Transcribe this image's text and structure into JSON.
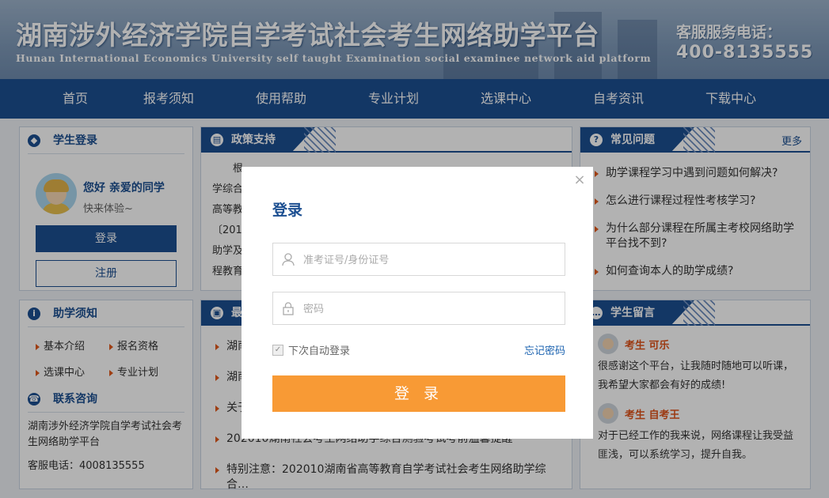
{
  "header": {
    "title": "湖南涉外经济学院自学考试社会考生网络助学平台",
    "subtitle": "Hunan International Economics University self taught Examination social examinee network aid platform",
    "hotline_label": "客服服务电话：",
    "hotline_number": "400-8135555"
  },
  "nav": {
    "items": [
      "首页",
      "报考须知",
      "使用帮助",
      "专业计划",
      "选课中心",
      "自考资讯",
      "下载中心"
    ]
  },
  "student_login": {
    "title": "学生登录",
    "greeting": "您好 亲爱的同学",
    "greeting_sub": "快来体验~",
    "login_label": "登录",
    "register_label": "注册"
  },
  "guide": {
    "title": "助学须知",
    "links": [
      "基本介绍",
      "报名资格",
      "选课中心",
      "专业计划"
    ]
  },
  "contact": {
    "title": "联系咨询",
    "text": "湖南涉外经济学院自学考试社会考生网络助学平台",
    "phone": "客服电话：4008135555"
  },
  "policy": {
    "title": "政策支持",
    "lines": [
      "根",
      "学综合",
      "高等教",
      "〔201",
      "助学及",
      "程教育"
    ]
  },
  "latest": {
    "title": "最",
    "items": [
      "湖南",
      "湖南",
      "关于",
      "202010湖南社会考生网络助学综合测验考试考前温馨提醒",
      "特别注意：202010湖南省高等教育自学考试社会考生网络助学综合…"
    ]
  },
  "faq": {
    "title": "常见问题",
    "more": "更多",
    "items": [
      "助学课程学习中遇到问题如何解决?",
      "怎么进行课程过程性考核学习?",
      "为什么部分课程在所属主考校网络助学平台找不到?",
      "如何查询本人的助学成绩?"
    ]
  },
  "messages": {
    "title": "学生留言",
    "items": [
      {
        "name": "考生 可乐",
        "text": "很感谢这个平台，让我随时随地可以听课，我希望大家都会有好的成绩!"
      },
      {
        "name": "考生 自考王",
        "text": "对于已经工作的我来说，网络课程让我受益匪浅，可以系统学习，提升自我。"
      }
    ]
  },
  "modal": {
    "title": "登录",
    "close": "×",
    "id_placeholder": "准考证号/身份证号",
    "password_placeholder": "密码",
    "remember_label": "下次自动登录",
    "forgot_label": "忘记密码",
    "submit_label": "登 录"
  }
}
